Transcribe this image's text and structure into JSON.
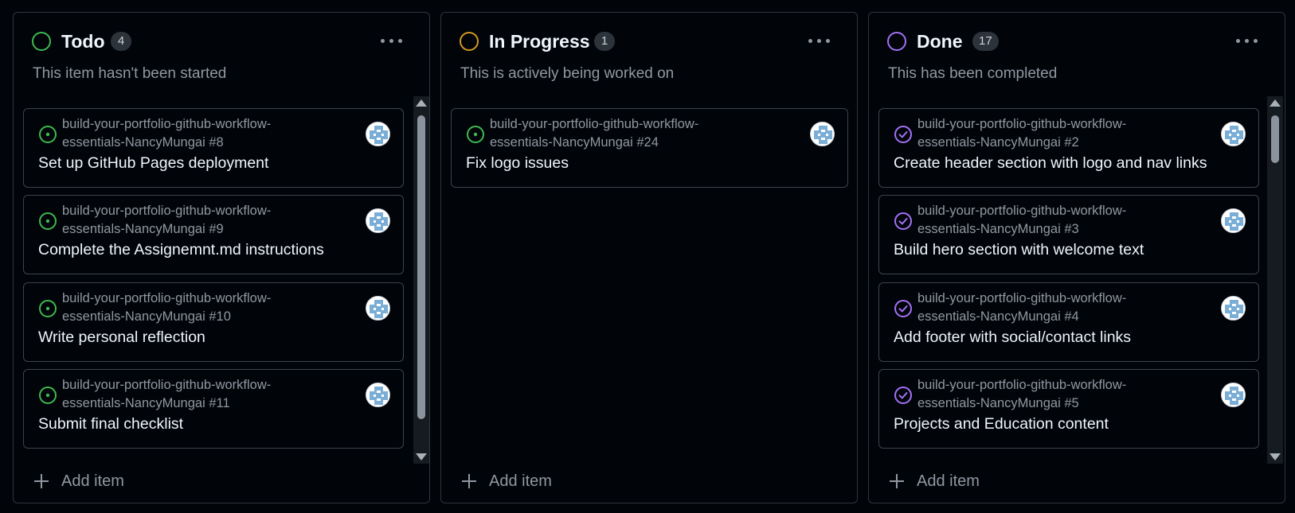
{
  "colors": {
    "todo": "#3fb950",
    "in_progress": "#d29922",
    "done": "#a371f7"
  },
  "columns": [
    {
      "title": "Todo",
      "count": "4",
      "description": "This item hasn't been started",
      "status_icon": "circle-outline-icon",
      "item_icon": "issue-open-icon",
      "add_label": "Add item",
      "has_scrollbar": true,
      "cards": [
        {
          "repo_line1": "build-your-portfolio-github-workflow-",
          "repo_line2": "essentials-NancyMungai #8",
          "title": "Set up GitHub Pages deployment"
        },
        {
          "repo_line1": "build-your-portfolio-github-workflow-",
          "repo_line2": "essentials-NancyMungai #9",
          "title": "Complete the Assignemnt.md instructions"
        },
        {
          "repo_line1": "build-your-portfolio-github-workflow-",
          "repo_line2": "essentials-NancyMungai #10",
          "title": "Write personal reflection"
        },
        {
          "repo_line1": "build-your-portfolio-github-workflow-",
          "repo_line2": "essentials-NancyMungai #11",
          "title": "Submit final checklist"
        }
      ]
    },
    {
      "title": "In Progress",
      "count": "1",
      "description": "This is actively being worked on",
      "status_icon": "circle-outline-icon",
      "item_icon": "issue-open-icon",
      "add_label": "Add item",
      "has_scrollbar": false,
      "cards": [
        {
          "repo_line1": "build-your-portfolio-github-workflow-",
          "repo_line2": "essentials-NancyMungai #24",
          "title": "Fix logo issues"
        }
      ]
    },
    {
      "title": "Done",
      "count": "17",
      "description": "This has been completed",
      "status_icon": "circle-outline-icon",
      "item_icon": "issue-closed-icon",
      "add_label": "Add item",
      "has_scrollbar": true,
      "cards": [
        {
          "repo_line1": "build-your-portfolio-github-workflow-",
          "repo_line2": "essentials-NancyMungai #2",
          "title": "Create header section with logo and nav links"
        },
        {
          "repo_line1": "build-your-portfolio-github-workflow-",
          "repo_line2": "essentials-NancyMungai #3",
          "title": "Build hero section with welcome text"
        },
        {
          "repo_line1": "build-your-portfolio-github-workflow-",
          "repo_line2": "essentials-NancyMungai #4",
          "title": "Add footer with social/contact links"
        },
        {
          "repo_line1": "build-your-portfolio-github-workflow-",
          "repo_line2": "essentials-NancyMungai #5",
          "title": "Projects and Education content"
        }
      ]
    }
  ]
}
